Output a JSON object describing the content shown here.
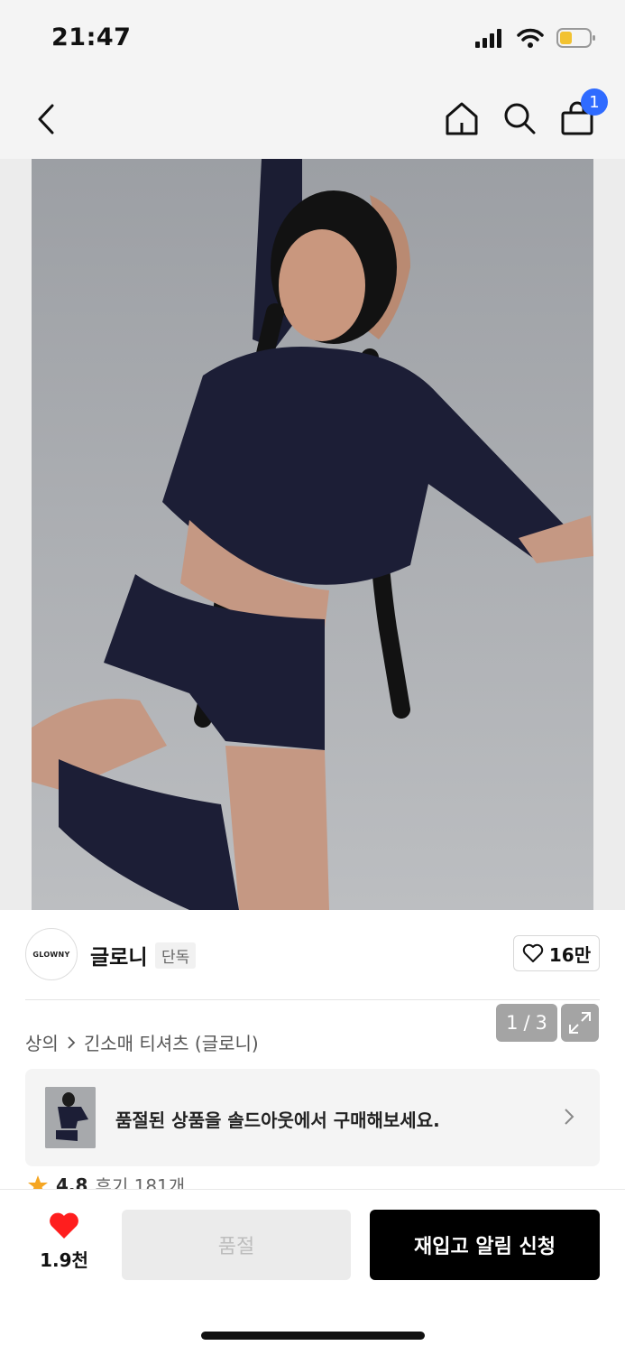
{
  "status_bar": {
    "time": "21:47"
  },
  "nav": {
    "cart_count": "1"
  },
  "gallery": {
    "pager_current": "1",
    "pager_sep": "/",
    "pager_total": "3"
  },
  "brand": {
    "logo_text": "GLOWNY",
    "name": "글로니",
    "tag": "단독",
    "likes": "16만"
  },
  "breadcrumb": {
    "category": "상의",
    "subcategory": "긴소매 티셔츠 (글로니)"
  },
  "soldout_banner": {
    "text": "품절된 상품을 솔드아웃에서 구매해보세요."
  },
  "rating": {
    "score": "4.8",
    "reviews": "후기 181개"
  },
  "bottom_bar": {
    "wish_count": "1.9천",
    "soldout_label": "품절",
    "restock_label": "재입고 알림 신청"
  },
  "colors": {
    "accent_blue": "#2f6bff",
    "wish_red": "#ff1e1e",
    "star": "#f5a623",
    "primary_button": "#000000"
  }
}
